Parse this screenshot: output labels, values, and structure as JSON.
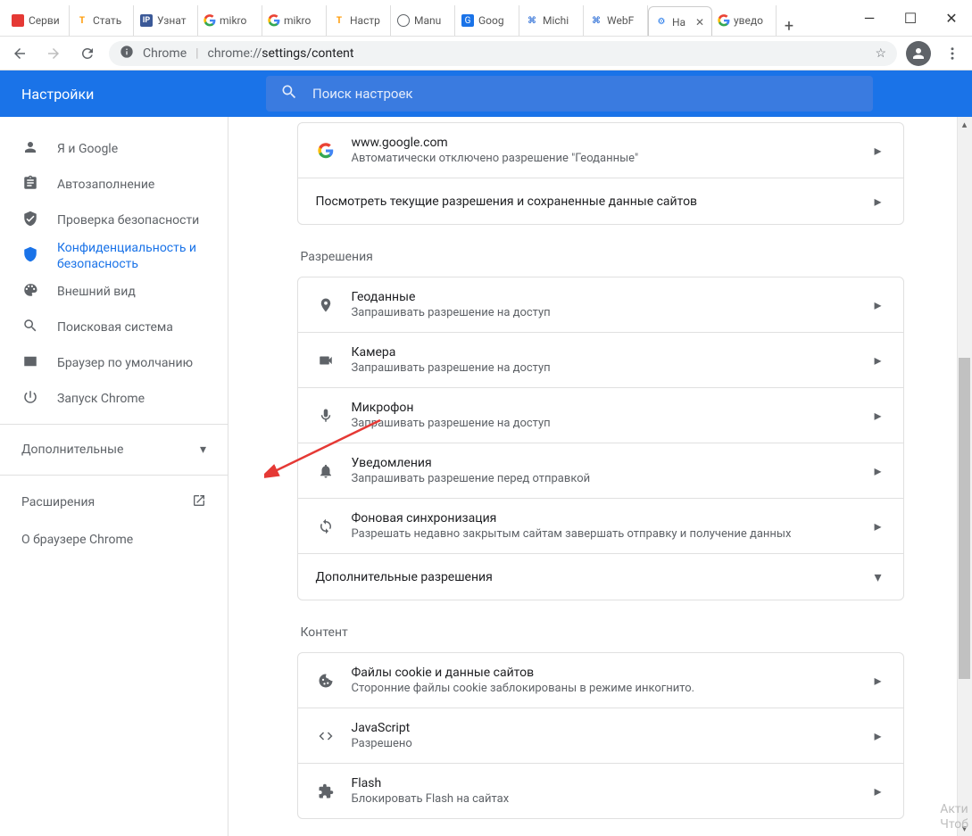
{
  "window": {
    "min": "—",
    "max": "☐",
    "close": "✕"
  },
  "tabs": {
    "list": [
      {
        "title": "Серви",
        "fav": "red"
      },
      {
        "title": "Стать",
        "fav": "t"
      },
      {
        "title": "Узнат",
        "fav": "ip"
      },
      {
        "title": "mikro",
        "fav": "g"
      },
      {
        "title": "mikro",
        "fav": "g"
      },
      {
        "title": "Настр",
        "fav": "t"
      },
      {
        "title": "Manu",
        "fav": "globe"
      },
      {
        "title": "Goog",
        "fav": "blue"
      },
      {
        "title": "Michi",
        "fav": "c"
      },
      {
        "title": "WebF",
        "fav": "c"
      },
      {
        "title": "На",
        "fav": "gear",
        "active": true,
        "closable": true
      },
      {
        "title": "уведо",
        "fav": "g"
      }
    ],
    "newtab": "+"
  },
  "toolbar": {
    "origin_label": "Chrome",
    "url_prefix": "chrome://",
    "url_path": "settings/content"
  },
  "header": {
    "title": "Настройки",
    "search_placeholder": "Поиск настроек"
  },
  "sidebar": {
    "items": [
      {
        "icon": "person",
        "label": "Я и Google"
      },
      {
        "icon": "assignment",
        "label": "Автозаполнение"
      },
      {
        "icon": "verified",
        "label": "Проверка безопасности"
      },
      {
        "icon": "security",
        "label": "Конфиденциальность и безопасность",
        "selected": true
      },
      {
        "icon": "palette",
        "label": "Внешний вид"
      },
      {
        "icon": "search",
        "label": "Поисковая система"
      },
      {
        "icon": "browser",
        "label": "Браузер по умолчанию"
      },
      {
        "icon": "power",
        "label": "Запуск Chrome"
      }
    ],
    "advanced": "Дополнительные",
    "extensions": "Расширения",
    "about": "О браузере Chrome"
  },
  "content": {
    "recent": {
      "site": "www.google.com",
      "sub": "Автоматически отключено разрешение \"Геоданные\"",
      "view_all": "Посмотреть текущие разрешения и сохраненные данные сайтов"
    },
    "permissions_label": "Разрешения",
    "permissions": [
      {
        "icon": "location",
        "title": "Геоданные",
        "sub": "Запрашивать разрешение на доступ"
      },
      {
        "icon": "camera",
        "title": "Камера",
        "sub": "Запрашивать разрешение на доступ"
      },
      {
        "icon": "mic",
        "title": "Микрофон",
        "sub": "Запрашивать разрешение на доступ"
      },
      {
        "icon": "bell",
        "title": "Уведомления",
        "sub": "Запрашивать разрешение перед отправкой"
      },
      {
        "icon": "sync",
        "title": "Фоновая синхронизация",
        "sub": "Разрешать недавно закрытым сайтам завершать отправку и получение данных"
      }
    ],
    "more_permissions": "Дополнительные разрешения",
    "content_label": "Контент",
    "content_items": [
      {
        "icon": "cookie",
        "title": "Файлы cookie и данные сайтов",
        "sub": "Сторонние файлы cookie заблокированы в режиме инкогнито."
      },
      {
        "icon": "code",
        "title": "JavaScript",
        "sub": "Разрешено"
      },
      {
        "icon": "extension",
        "title": "Flash",
        "sub": "Блокировать Flash на сайтах"
      }
    ]
  },
  "watermark": {
    "l1": "Акти",
    "l2": "Чтоб"
  }
}
